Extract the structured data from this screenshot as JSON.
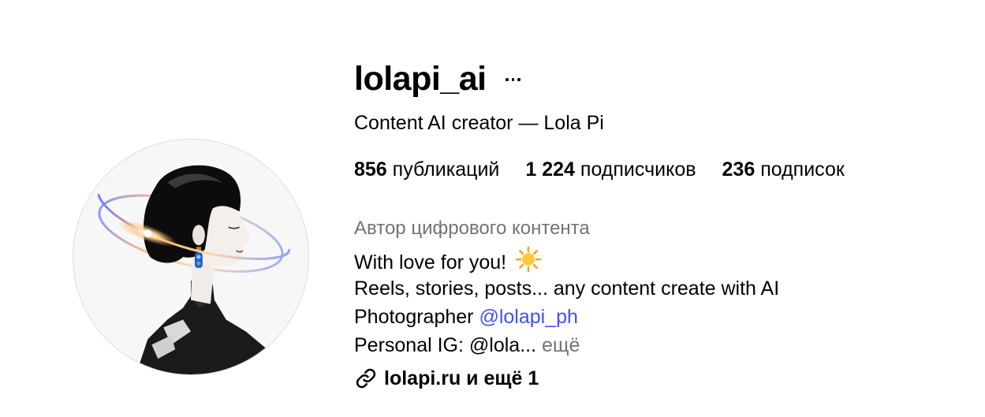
{
  "profile": {
    "username": "lolapi_ai",
    "full_name": "Content AI creator — Lola Pi",
    "more_icon": "more-horizontal-icon",
    "avatar_icon": "profile-avatar"
  },
  "stats": {
    "posts_count": "856",
    "posts_label": "публикаций",
    "followers_count": "1 224",
    "followers_label": "подписчиков",
    "following_count": "236",
    "following_label": "подписок"
  },
  "bio": {
    "category": "Автор цифрового контента",
    "line1_text": "With love for you!",
    "line1_emoji_icon": "sun-emoji-icon",
    "line2_text": "Reels, stories, posts... any content create with AI",
    "line3_prefix": "Photographer",
    "line3_mention": "@lolapi_ph",
    "line4_text": "Personal IG: @lola...",
    "more_label": "ещё"
  },
  "links": {
    "icon": "link-icon",
    "label": "lolapi.ru и ещё 1"
  },
  "colors": {
    "mention": "#4150f7",
    "secondary_text": "#737373",
    "primary_text": "#000000",
    "avatar_border": "#dbdbdb"
  }
}
